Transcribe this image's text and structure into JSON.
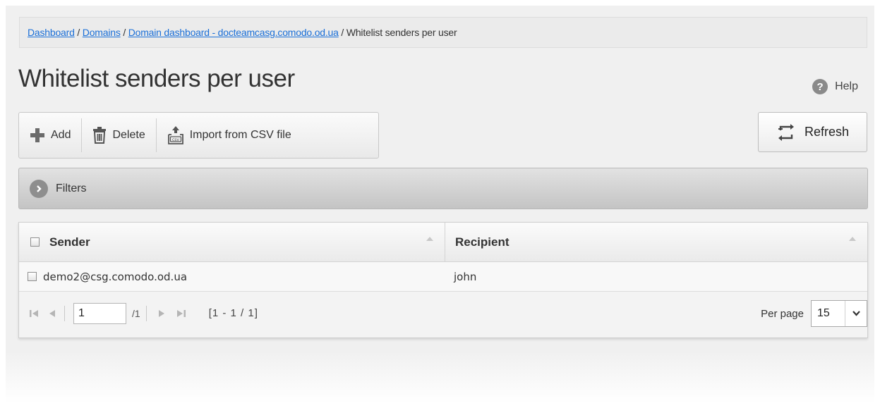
{
  "breadcrumb": {
    "items": [
      "Dashboard",
      "Domains",
      "Domain dashboard - docteamcasg.comodo.od.ua"
    ],
    "current": "Whitelist senders per user",
    "separator": " / "
  },
  "page": {
    "title": "Whitelist senders per user",
    "help_label": "Help"
  },
  "toolbar": {
    "add_label": "Add",
    "delete_label": "Delete",
    "import_label": "Import from CSV file",
    "refresh_label": "Refresh"
  },
  "filters": {
    "label": "Filters"
  },
  "table": {
    "columns": [
      "Sender",
      "Recipient"
    ],
    "rows": [
      {
        "sender": "demo2@csg.comodo.od.ua",
        "recipient": "john"
      }
    ]
  },
  "pager": {
    "page_value": "1",
    "total_pages": "/1",
    "range": "[1 - 1 / 1]",
    "per_page_label": "Per page",
    "per_page_value": "15"
  },
  "colors": {
    "link": "#1a6fd8",
    "add_icon": "#6b6b6b",
    "filters_bar": "#c4c4c4"
  },
  "icons": [
    "plus-icon",
    "trash-icon",
    "csv-upload-icon",
    "refresh-icon",
    "help-icon",
    "chevron-right-icon",
    "sort-arrow-icon",
    "first-page-icon",
    "prev-page-icon",
    "next-page-icon",
    "last-page-icon",
    "chevron-down-icon"
  ]
}
